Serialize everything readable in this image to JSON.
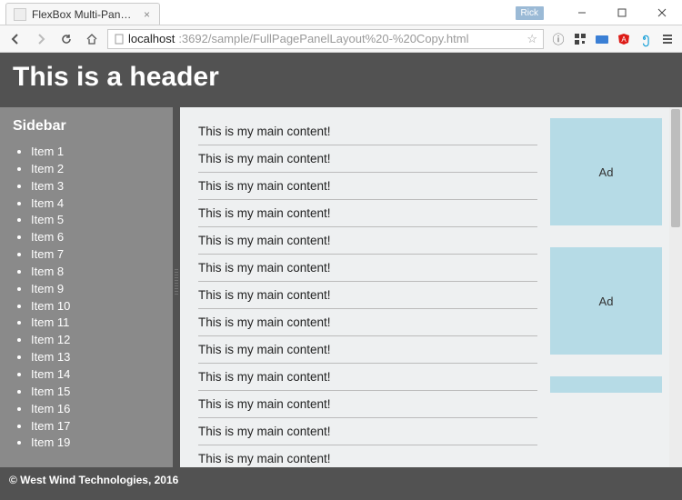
{
  "browser": {
    "tab_title": "FlexBox Multi-Panel L",
    "user_badge": "Rick",
    "url_host": "localhost",
    "url_rest": ":3692/sample/FullPagePanelLayout%20-%20Copy.html"
  },
  "header": {
    "title": "This is a header"
  },
  "sidebar": {
    "title": "Sidebar",
    "items": [
      "Item 1",
      "Item 2",
      "Item 3",
      "Item 4",
      "Item 5",
      "Item 6",
      "Item 7",
      "Item 8",
      "Item 9",
      "Item 10",
      "Item 11",
      "Item 12",
      "Item 13",
      "Item 14",
      "Item 15",
      "Item 16",
      "Item 17",
      "Item 19"
    ]
  },
  "main": {
    "content_line": "This is my main content!",
    "line_count": 13
  },
  "ads": {
    "label": "Ad"
  },
  "footer": {
    "text": "© West Wind Technologies, 2016"
  }
}
